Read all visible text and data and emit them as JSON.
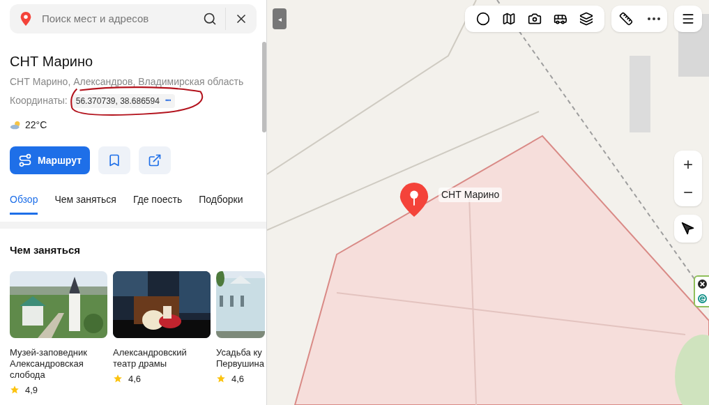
{
  "search": {
    "placeholder": "Поиск мест и адресов"
  },
  "place": {
    "title": "СНТ Марино",
    "address": "СНТ Марино, Александров, Владимирская область",
    "coords_label": "Координаты:",
    "coords": "56.370739, 38.686594",
    "more": "•••",
    "weather": "22°C"
  },
  "actions": {
    "route": "Маршрут"
  },
  "tabs": [
    {
      "label": "Обзор",
      "selected": true
    },
    {
      "label": "Чем заняться",
      "selected": false
    },
    {
      "label": "Где поесть",
      "selected": false
    },
    {
      "label": "Подборки",
      "selected": false
    }
  ],
  "section": {
    "title": "Чем заняться",
    "cards": [
      {
        "kind": "church",
        "title": "Музей-заповедник Александровская слобода",
        "rating": "4,9"
      },
      {
        "kind": "theatre",
        "title": "Александровский театр драмы",
        "rating": "4,6"
      },
      {
        "kind": "building",
        "title": "Усадьба ку Первушина",
        "rating": "4,6"
      }
    ]
  },
  "map": {
    "collapse": "◂",
    "placemark": "СНТ Марино",
    "zoom_in": "+",
    "zoom_out": "−"
  }
}
